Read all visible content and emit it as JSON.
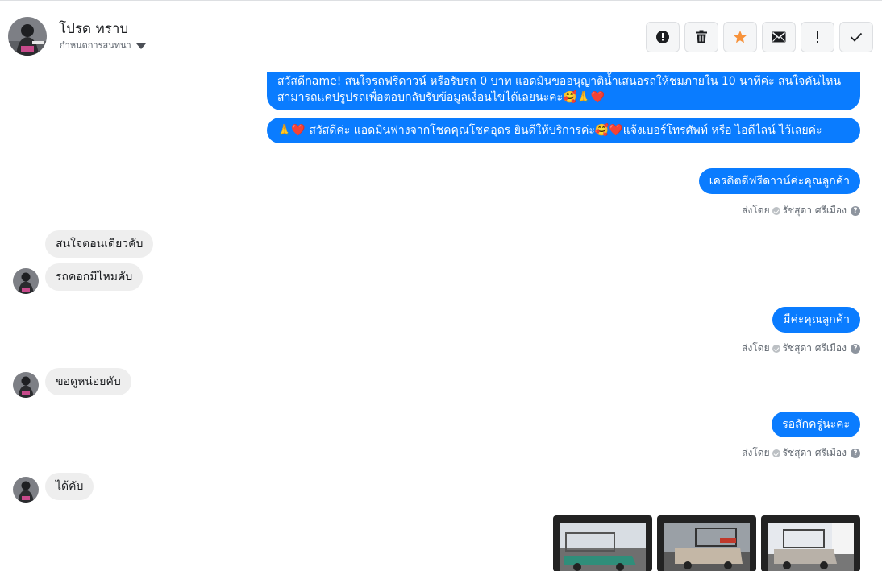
{
  "header": {
    "name": "โปรด ทราบ",
    "assign_label": "กำหนดการสนทนา"
  },
  "toolbar": {
    "buttons": [
      "mark-spam",
      "delete",
      "star",
      "mark-unread",
      "follow-up",
      "done"
    ]
  },
  "messages": {
    "out1": "สวัสดีname! สนใจรถฟรีดาวน์ หรือรับรถ 0 บาท แอดมินขออนุญาติน้ำเสนอรถให้ชมภายใน 10 นาทีค่ะ สนใจคันไหนสามารถแคปรูปรถเพื่อตอบกลับรับข้อมูลเงื่อนไขได้เลยนะคะ🥰🙏❤️",
    "out2": "🙏❤️ สวัสดีค่ะ แอดมินฟางจากโชคคุณโชคอุดร ยินดีให้บริการค่ะ🥰❤️แจ้งเบอร์โทรศัพท์ หรือ ไอดีไลน์  ไว้เลยค่ะ",
    "out3": "เครดิตดีฟรีดาวน์ค่ะคุณลูกค้า",
    "in1": "สนใจตอนเดียวคับ",
    "in2": "รถคอกมีไหมคับ",
    "out4": "มีค่ะคุณลูกค้า",
    "in3": "ขอดูหน่อยคับ",
    "out5": "รอสักครู่นะคะ",
    "in4": "ได้คับ"
  },
  "sent_by": {
    "prefix": "ส่งโดย",
    "agent": "รัชสุดา ศรีเมือง"
  },
  "colors": {
    "outgoing_bubble": "#0a7cff",
    "incoming_bubble": "#eeeeee",
    "star": "#f7923a"
  }
}
